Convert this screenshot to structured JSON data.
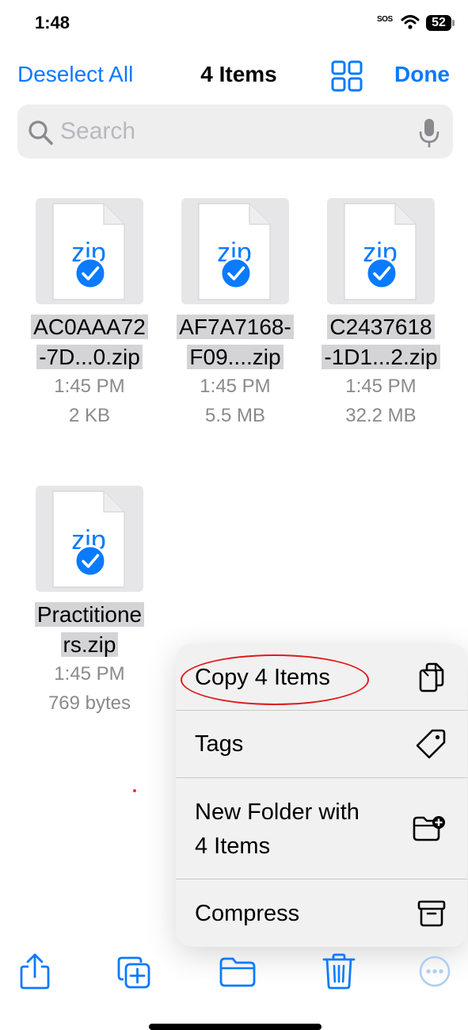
{
  "status_bar": {
    "time": "1:48",
    "sos": "SOS",
    "battery": "52"
  },
  "nav": {
    "deselect_label": "Deselect All",
    "title": "4 Items",
    "done_label": "Done"
  },
  "search": {
    "placeholder": "Search"
  },
  "files": [
    {
      "name_line1": "AC0AAA72",
      "name_line2": "-7D...0.zip",
      "time": "1:45 PM",
      "size": "2 KB",
      "icon_label": "zip"
    },
    {
      "name_line1": "AF7A7168-",
      "name_line2": "F09....zip",
      "time": "1:45 PM",
      "size": "5.5 MB",
      "icon_label": "zip"
    },
    {
      "name_line1": "C2437618",
      "name_line2": "-1D1...2.zip",
      "time": "1:45 PM",
      "size": "32.2 MB",
      "icon_label": "zip"
    },
    {
      "name_line1": "Practitione",
      "name_line2": "rs.zip",
      "time": "1:45 PM",
      "size": "769 bytes",
      "icon_label": "zip"
    }
  ],
  "menu": {
    "items": [
      {
        "label": "Copy 4 Items",
        "icon": "copy-icon"
      },
      {
        "label": "Tags",
        "icon": "tag-icon"
      },
      {
        "label_line1": "New Folder with",
        "label_line2": "4 Items",
        "icon": "folder-plus-icon"
      },
      {
        "label": "Compress",
        "icon": "archive-icon"
      }
    ]
  },
  "toolbar": {
    "icons": [
      "share-icon",
      "duplicate-icon",
      "move-folder-icon",
      "trash-icon",
      "more-icon"
    ]
  },
  "colors": {
    "accent": "#0A7AFF",
    "annotation": "#E01A1A"
  }
}
